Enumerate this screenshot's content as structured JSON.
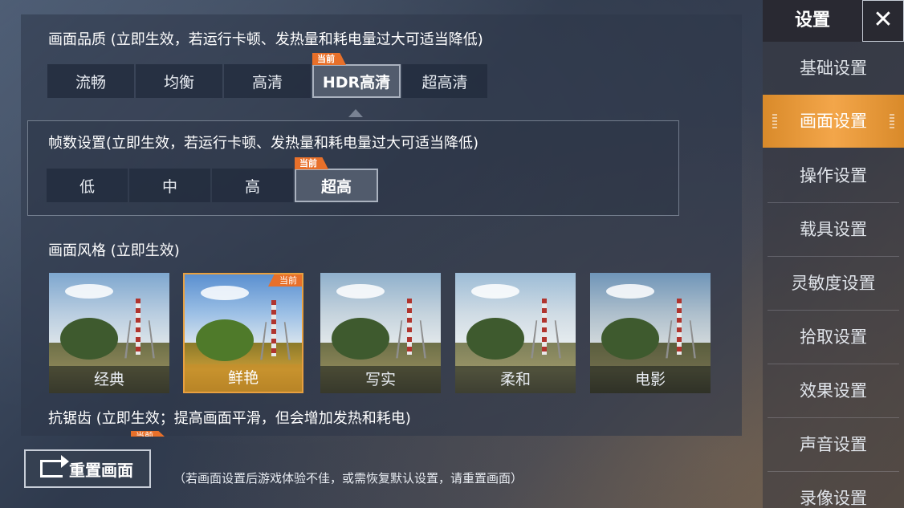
{
  "sidebar": {
    "title": "设置",
    "close_label": "✕",
    "items": [
      {
        "label": "基础设置"
      },
      {
        "label": "画面设置"
      },
      {
        "label": "操作设置"
      },
      {
        "label": "载具设置"
      },
      {
        "label": "灵敏度设置"
      },
      {
        "label": "拾取设置"
      },
      {
        "label": "效果设置"
      },
      {
        "label": "声音设置"
      },
      {
        "label": "录像设置"
      }
    ],
    "active_index": 1
  },
  "quality": {
    "heading": "画面品质 (立即生效，若运行卡顿、发热量和耗电量过大可适当降低)",
    "options": [
      "流畅",
      "均衡",
      "高清",
      "HDR高清",
      "超高清"
    ],
    "selected_index": 3,
    "badge": "当前"
  },
  "fps": {
    "heading": "帧数设置(立即生效，若运行卡顿、发热量和耗电量过大可适当降低)",
    "options": [
      "低",
      "中",
      "高",
      "超高"
    ],
    "selected_index": 3,
    "badge": "当前"
  },
  "style": {
    "heading": "画面风格 (立即生效)",
    "options": [
      "经典",
      "鲜艳",
      "写实",
      "柔和",
      "电影"
    ],
    "selected_index": 1,
    "badge": "当前"
  },
  "antialias": {
    "heading": "抗锯齿 (立即生效；提高画面平滑，但会增加发热和耗电)",
    "badge": "当前"
  },
  "reset": {
    "label": "重置画面",
    "note": "（若画面设置后游戏体验不佳，或需恢复默认设置，请重置画面）"
  }
}
